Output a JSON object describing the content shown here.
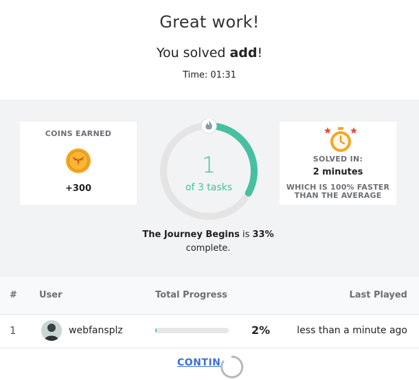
{
  "header": {
    "title": "Great work!",
    "solved_prefix": "You solved ",
    "solved_name": "add",
    "solved_suffix": "!",
    "time": "Time: 01:31"
  },
  "coins": {
    "label": "COINS EARNED",
    "value": "+300",
    "icon": "coin-icon"
  },
  "progress": {
    "count": "1",
    "of_tasks": "of 3 tasks",
    "fraction": 0.33,
    "icon": "flame-icon",
    "journey_name": "The Journey Begins",
    "journey_is": " is ",
    "journey_pct": "33%",
    "journey_complete": "complete."
  },
  "solved_in": {
    "label": "SOLVED IN:",
    "value": "2 minutes",
    "faster_line1": "WHICH IS 100% FASTER",
    "faster_line2": "THAN THE AVERAGE",
    "icon": "stopwatch-icon"
  },
  "table": {
    "headers": {
      "rank": "#",
      "user": "User",
      "progress": "Total Progress",
      "last": "Last Played"
    },
    "rows": [
      {
        "rank": "1",
        "user": "webfansplz",
        "progress_fraction": 0.02,
        "progress_text": "2%",
        "last": "less than a minute ago"
      }
    ]
  },
  "continue_label": "CONTIN",
  "colors": {
    "accent": "#46c0a0",
    "link": "#3b6fd6",
    "coin": "#f5a623",
    "ring_bg": "#e4e4e4"
  }
}
